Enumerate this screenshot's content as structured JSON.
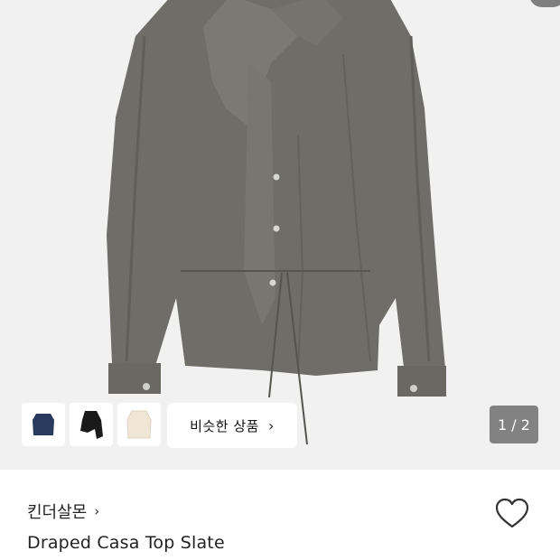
{
  "pager": {
    "text": "1 / 2"
  },
  "similar": {
    "button_label": "비슷한 상품",
    "chevron": "›",
    "thumbnails": [
      {
        "icon": "navy-blouse-thumbnail",
        "color": "#2a3a5e"
      },
      {
        "icon": "black-top-thumbnail",
        "color": "#1a1a1a"
      },
      {
        "icon": "cream-blouse-thumbnail",
        "color": "#efe6d6"
      }
    ]
  },
  "product": {
    "brand": "킨더살몬",
    "brand_chevron": "›",
    "name": "Draped Casa Top Slate",
    "garment_color": "#6e6d67"
  },
  "icons": {
    "favorite": "heart-outline-icon"
  }
}
